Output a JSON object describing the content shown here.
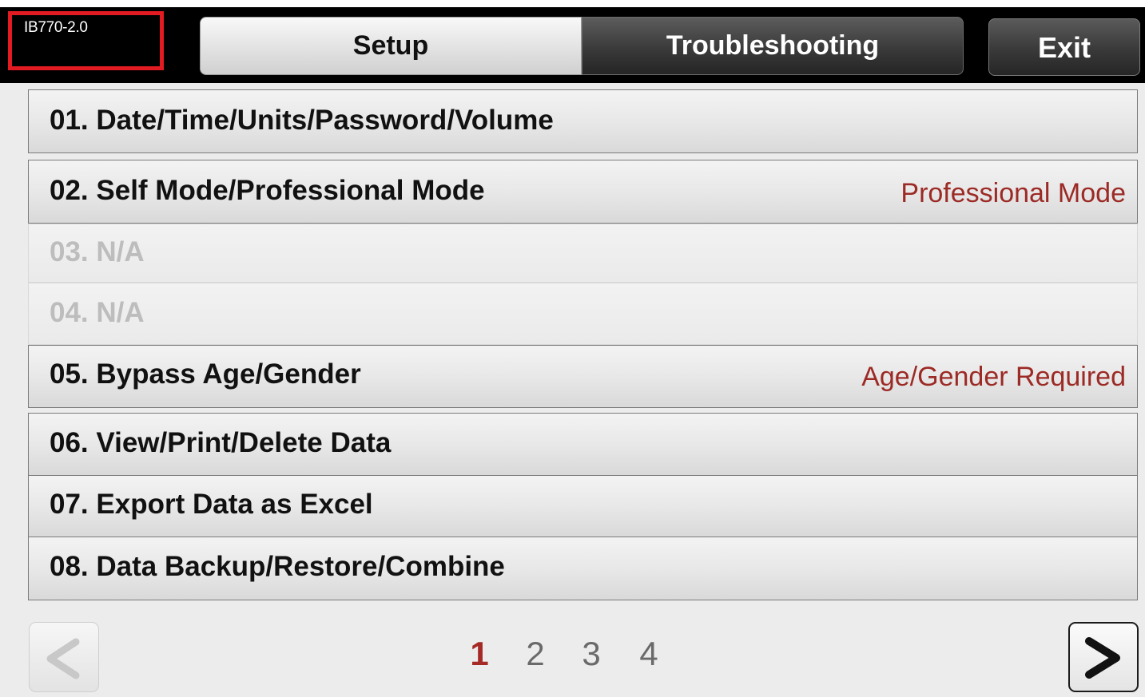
{
  "header": {
    "version_label": "IB770-2.0",
    "tabs": [
      {
        "label": "Setup",
        "active": true
      },
      {
        "label": "Troubleshooting",
        "active": false
      }
    ],
    "exit_label": "Exit"
  },
  "menu": {
    "items": [
      {
        "label": "01. Date/Time/Units/Password/Volume",
        "value": "",
        "enabled": true
      },
      {
        "label": "02. Self Mode/Professional Mode",
        "value": "Professional Mode",
        "enabled": true
      },
      {
        "label": "03. N/A",
        "value": "",
        "enabled": false
      },
      {
        "label": "04. N/A",
        "value": "",
        "enabled": false
      },
      {
        "label": "05. Bypass Age/Gender",
        "value": "Age/Gender Required",
        "enabled": true
      },
      {
        "label": "06. View/Print/Delete Data",
        "value": "",
        "enabled": true
      },
      {
        "label": "07. Export Data as Excel",
        "value": "",
        "enabled": true
      },
      {
        "label": "08. Data Backup/Restore/Combine",
        "value": "",
        "enabled": true
      }
    ]
  },
  "pagination": {
    "pages": [
      "1",
      "2",
      "3",
      "4"
    ],
    "current": "1",
    "prev_icon": "chevron-left-icon",
    "next_icon": "chevron-right-icon"
  },
  "colors": {
    "value_text": "#9c2a25",
    "current_page": "#a52a25",
    "version_border": "#e21b23"
  }
}
